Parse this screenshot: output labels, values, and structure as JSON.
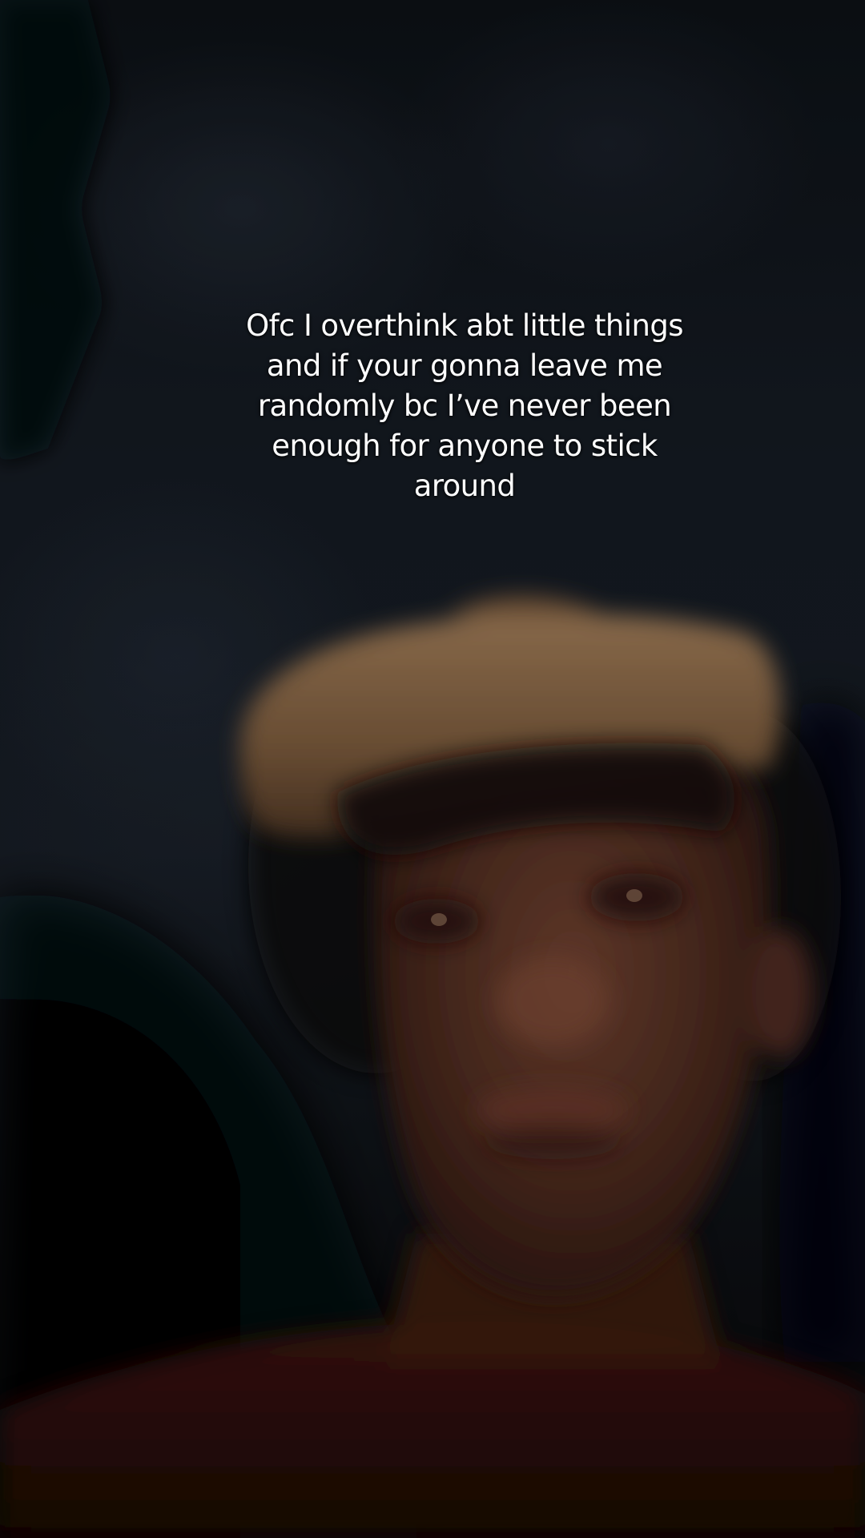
{
  "caption": {
    "text": "Ofc I overthink abt little things and if your gonna leave me randomly bc I’ve never been enough for anyone to stick around"
  },
  "photo": {
    "subject": "person-in-cap-at-night",
    "colors": {
      "sky": "#161c24",
      "cap": "#8a6a4a",
      "skin": "#5a3424",
      "shirt": "#2a0e08",
      "foliage": "#05070a"
    }
  }
}
